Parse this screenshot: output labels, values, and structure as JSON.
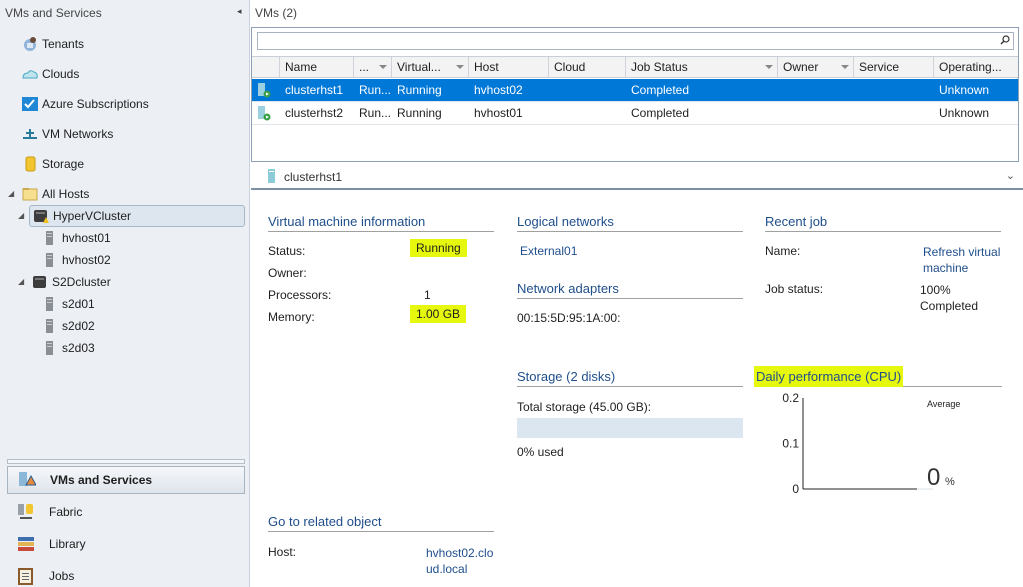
{
  "sidebar": {
    "title": "VMs and Services",
    "collapse_glyph": "◂",
    "nav_items": [
      {
        "label": "Tenants",
        "icon": "tenants-icon"
      },
      {
        "label": "Clouds",
        "icon": "cloud-icon"
      },
      {
        "label": "Azure Subscriptions",
        "icon": "azure-subscriptions-icon"
      },
      {
        "label": "VM Networks",
        "icon": "vm-network-icon"
      },
      {
        "label": "Storage",
        "icon": "storage-icon"
      }
    ],
    "tree": {
      "root": {
        "label": "All Hosts",
        "icon": "folder-icon",
        "expanded": true
      },
      "clusters": [
        {
          "label": "HyperVCluster",
          "icon": "cluster-warning-icon",
          "selected": true,
          "hosts": [
            "hvhost01",
            "hvhost02"
          ]
        },
        {
          "label": "S2Dcluster",
          "icon": "cluster-icon",
          "selected": false,
          "hosts": [
            "s2d01",
            "s2d02",
            "s2d03"
          ]
        }
      ]
    },
    "workspaces": [
      {
        "label": "VMs and Services",
        "icon": "vms-services-icon",
        "active": true
      },
      {
        "label": "Fabric",
        "icon": "fabric-icon",
        "active": false
      },
      {
        "label": "Library",
        "icon": "library-icon",
        "active": false
      },
      {
        "label": "Jobs",
        "icon": "jobs-icon",
        "active": false
      }
    ]
  },
  "vms": {
    "title": "VMs (2)",
    "search": {
      "value": "",
      "placeholder": ""
    },
    "columns": [
      "",
      "Name",
      "...",
      "Virtual...",
      "Host",
      "Cloud",
      "Job Status",
      "Owner",
      "Service",
      "Operating..."
    ],
    "rows": [
      {
        "name": "clusterhst1",
        "status": "Run...",
        "virtual": "Running",
        "host": "hvhost02",
        "cloud": "",
        "job_status": "Completed",
        "owner": "",
        "service": "",
        "os": "Unknown",
        "selected": true
      },
      {
        "name": "clusterhst2",
        "status": "Run...",
        "virtual": "Running",
        "host": "hvhost01",
        "cloud": "",
        "job_status": "Completed",
        "owner": "",
        "service": "",
        "os": "Unknown",
        "selected": false
      }
    ]
  },
  "details": {
    "name": "clusterhst1",
    "chevron": "⌄",
    "vm_info": {
      "title": "Virtual machine information",
      "status_label": "Status:",
      "status_value": "Running",
      "owner_label": "Owner:",
      "owner_value": "",
      "processors_label": "Processors:",
      "processors_value": "1",
      "memory_label": "Memory:",
      "memory_value": "1.00 GB"
    },
    "logical_networks": {
      "title": "Logical networks",
      "value": "External01"
    },
    "network_adapters": {
      "title": "Network adapters",
      "value": "00:15:5D:95:1A:00:"
    },
    "recent_job": {
      "title": "Recent job",
      "name_label": "Name:",
      "name_value_1": "Refresh virtual",
      "name_value_2": "machine",
      "status_label": "Job status:",
      "status_value_1": "100%",
      "status_value_2": "Completed"
    },
    "storage": {
      "title": "Storage (2 disks)",
      "total_label": "Total storage (45.00 GB):",
      "used_fraction": 0,
      "used_label": "0% used"
    },
    "performance": {
      "title": "Daily performance (CPU)",
      "average_label": "Average",
      "average_value": "0",
      "average_unit": "%"
    },
    "related": {
      "title": "Go to related object",
      "host_label": "Host:",
      "host_value_1": "hvhost02.clo",
      "host_value_2": "ud.local"
    }
  },
  "chart_data": {
    "type": "line",
    "title": "Daily performance (CPU)",
    "xlabel": "",
    "ylabel": "",
    "yticks": [
      "0.2",
      "0.1",
      "0"
    ],
    "ylim": [
      0,
      0.2
    ],
    "series": [
      {
        "name": "CPU",
        "values": []
      }
    ],
    "annotation": "Average 0 %"
  },
  "colors": {
    "selection": "#0078d7",
    "highlight": "#e6f80e",
    "section_title": "#1f4e8c"
  }
}
